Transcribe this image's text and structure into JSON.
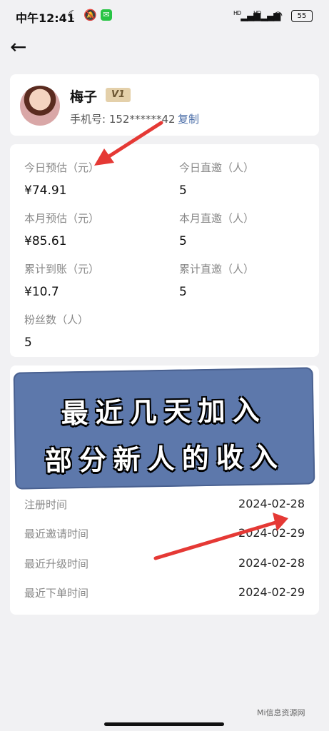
{
  "status_bar": {
    "time": "中午12:41",
    "signal1": "HD",
    "signal2": "HD",
    "battery": "55"
  },
  "profile": {
    "name": "梅子",
    "level": "V1",
    "phone": "手机号: 152******42",
    "copy_label": "复制"
  },
  "stats": [
    {
      "label": "今日预估（元）",
      "value": "¥74.91"
    },
    {
      "label": "今日直邀（人）",
      "value": "5"
    },
    {
      "label": "本月预估（元）",
      "value": "¥85.61"
    },
    {
      "label": "本月直邀（人）",
      "value": "5"
    },
    {
      "label": "累计到账（元）",
      "value": "¥10.7"
    },
    {
      "label": "累计直邀（人）",
      "value": "5"
    },
    {
      "label": "粉丝数（人）",
      "value": "5"
    }
  ],
  "banner": {
    "line1": "最近几天加入",
    "line2": "部分新人的收入"
  },
  "info_rows": [
    {
      "key": "注册时间",
      "value": "2024-02-28"
    },
    {
      "key": "最近邀请时间",
      "value": "2024-02-29"
    },
    {
      "key": "最近升级时间",
      "value": "2024-02-28"
    },
    {
      "key": "最近下单时间",
      "value": "2024-02-29"
    }
  ],
  "watermark": "Mi信息资源网",
  "colors": {
    "accent_link": "#4b6ea8",
    "badge_bg": "#e4d0aa",
    "banner_bg": "#5d78ab",
    "arrow": "#e53935"
  }
}
